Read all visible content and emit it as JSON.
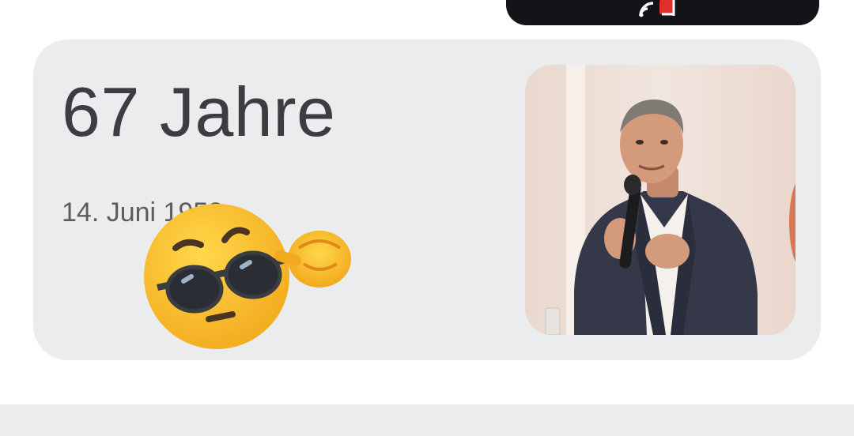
{
  "age_card": {
    "age_label": "67 Jahre",
    "birth_date": "14. Juni 1958"
  },
  "icons": {
    "cast": "cast-icon",
    "emoji": "sunglasses-thinking-emoji"
  },
  "colors": {
    "card_background": "#ebecee",
    "top_pill": "#121417",
    "title_text": "#3c3d40",
    "subtitle_text": "#5b5c5f",
    "cast_accent": "#e0302a"
  }
}
